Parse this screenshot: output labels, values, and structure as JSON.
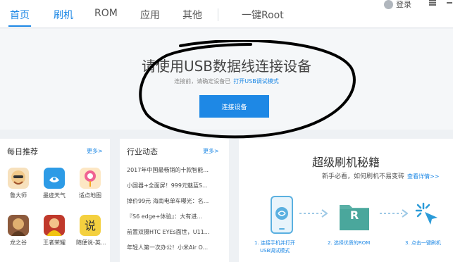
{
  "topbar": {
    "tabs": [
      {
        "label": "首页"
      },
      {
        "label": "刷机"
      },
      {
        "label": "ROM"
      },
      {
        "label": "应用"
      },
      {
        "label": "其他"
      }
    ],
    "root": "一键Root",
    "login": "登录"
  },
  "hero": {
    "title": "请使用USB数据线连接设备",
    "subtitle": "连接前，请确定设备已",
    "debug_link": "打开USB调试模式",
    "connect_button": "连接设备"
  },
  "daily": {
    "title": "每日推荐",
    "more": "更多>",
    "apps": [
      {
        "label": "鲁大师",
        "color": "#f2c98a"
      },
      {
        "label": "墨迹天气",
        "color": "#2d9be6"
      },
      {
        "label": "适点地图",
        "color": "#f5a623"
      },
      {
        "label": "龙之谷",
        "color": "#8c5a3c"
      },
      {
        "label": "王者荣耀",
        "color": "#c0392b"
      },
      {
        "label": "随便说-英...",
        "color": "#f4d03f"
      }
    ]
  },
  "news": {
    "title": "行业动态",
    "more": "更多>",
    "items": [
      "2017年中国最畅销的十款智能...",
      "小国器+全面屏！999元魅蓝S...",
      "掉价99元 海南电单车曝光：名...",
      "『S6 edge+体验』：大有进...",
      "前置双摄HTC EYEs面世，U11...",
      "年轻人第一次办公！小米Air O..."
    ]
  },
  "secret": {
    "title": "超级刷机秘籍",
    "subtitle": "新手必看，如何刷机不易变砖",
    "details": "查看详情>>",
    "card_letter": "R",
    "steps": [
      {
        "line1": "1. 连接手机并打开",
        "line2": "USB调试模式"
      },
      {
        "line1": "2. 选择优质的ROM",
        "line2": ""
      },
      {
        "line1": "3. 点击一键刷机",
        "line2": ""
      }
    ]
  }
}
